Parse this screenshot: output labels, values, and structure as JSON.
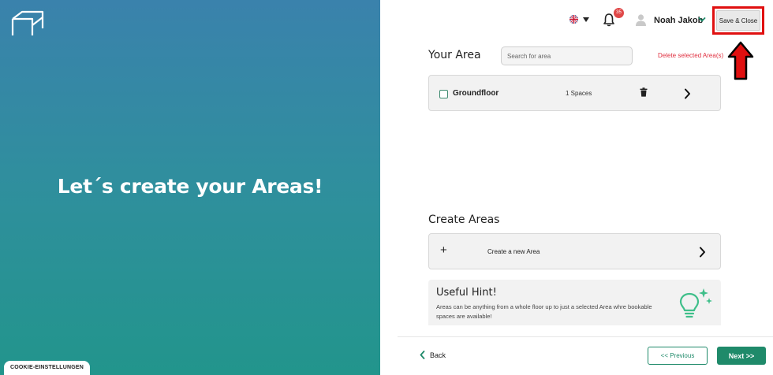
{
  "hero": {
    "title": "Let´s create your Areas!"
  },
  "cookie": {
    "label": "COOKIE-EINSTELLUNGEN"
  },
  "header": {
    "language_flag": "uk-flag-icon",
    "notifications_count": "35",
    "user_name": "Noah Jakob",
    "save_close_label": "Save & Close"
  },
  "your_area": {
    "title": "Your Area",
    "search_placeholder": "Search for area",
    "delete_label": "Delete selected Area(s)",
    "items": [
      {
        "name": "Groundfloor",
        "spaces": "1 Spaces"
      }
    ]
  },
  "create_areas": {
    "title": "Create Areas",
    "plus": "+",
    "button_label": "Create a new Area"
  },
  "hint": {
    "title": "Useful Hint!",
    "text": "Areas can be anything from a whole floor up to just a selected Area whre bookable spaces are available!"
  },
  "footer": {
    "back_label": "Back",
    "previous_label": "<< Previous",
    "next_label": "Next >>"
  },
  "colors": {
    "accent": "#1f8a6a",
    "danger": "#e03040",
    "highlight": "#e01010"
  }
}
